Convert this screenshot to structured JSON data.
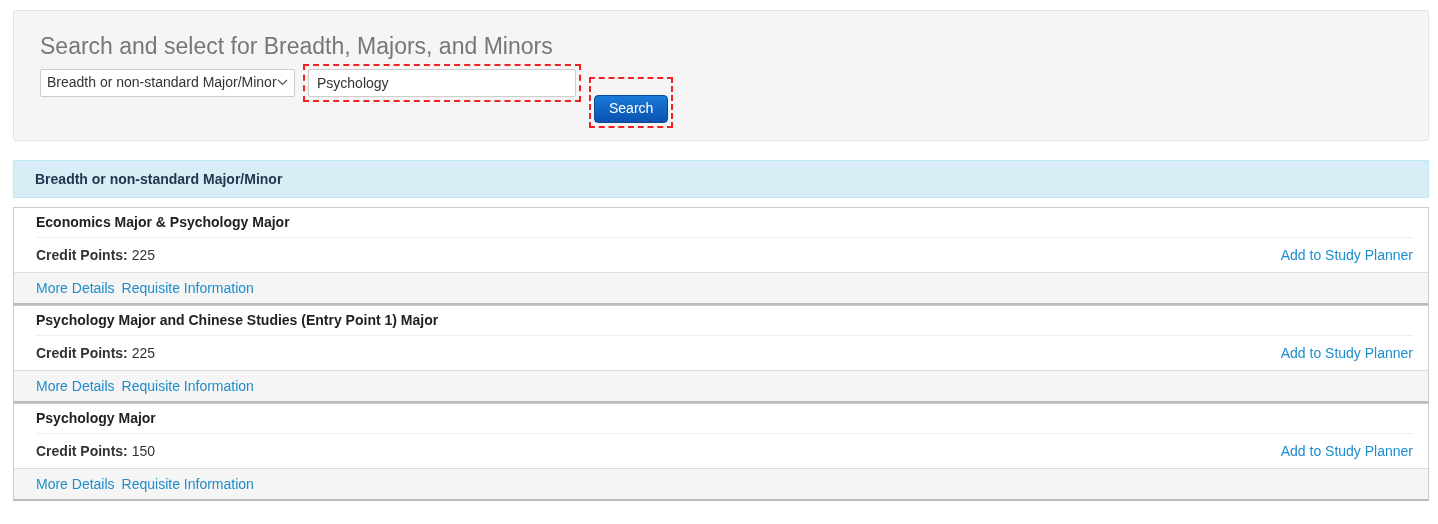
{
  "search_panel": {
    "title": "Search and select for Breadth, Majors, and Minors",
    "type_select": {
      "value": "Breadth or non-standard Major/Minor"
    },
    "search_field": {
      "value": "Psychology",
      "highlighted": true
    },
    "search_button": {
      "label": "Search",
      "highlighted": true
    }
  },
  "results_header": "Breadth or non-standard Major/Minor",
  "results": [
    {
      "title": "Economics Major & Psychology Major",
      "credit_points": "**Credit Points:** 225",
      "add_link": "Add to Study Planner",
      "links": [
        "More Details",
        "Requisite Information"
      ]
    },
    {
      "title": "Psychology Major and Chinese Studies (Entry Point 1) Major",
      "credit_points": "**Credit Points:** 225",
      "add_link": "Add to Study Planner",
      "links": [
        "More Details",
        "Requisite Information"
      ]
    },
    {
      "title": "Psychology Major",
      "credit_points": "**Credit Points:** 150",
      "add_link": "Add to Study Planner",
      "links": [
        "More Details",
        "Requisite Information"
      ]
    }
  ]
}
